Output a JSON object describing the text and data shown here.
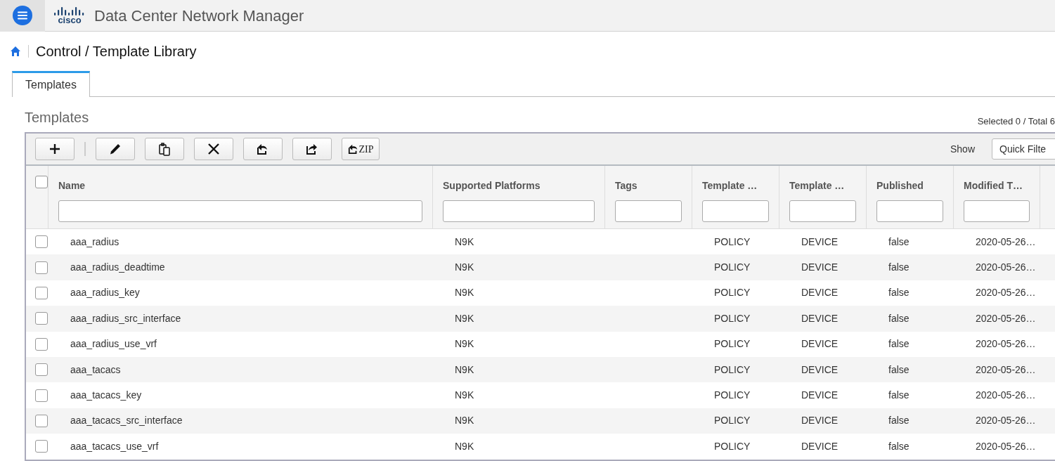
{
  "header": {
    "logo_text": "cisco",
    "title": "Data Center Network Manager"
  },
  "breadcrumb": "Control / Template Library",
  "tabs": [
    {
      "label": "Templates",
      "selected": true
    }
  ],
  "section": {
    "title": "Templates",
    "count": "Selected 0 / Total 6"
  },
  "toolbar": {
    "buttons": [
      {
        "kind": "add"
      },
      {
        "kind": "edit"
      },
      {
        "kind": "copy"
      },
      {
        "kind": "delete"
      },
      {
        "kind": "import"
      },
      {
        "kind": "export"
      },
      {
        "kind": "zip",
        "label": "ZIP"
      }
    ],
    "show_label": "Show",
    "filter": "Quick Filte"
  },
  "table": {
    "select_all": {
      "checked": false
    },
    "columns": [
      "Name",
      "Supported Platforms",
      "Tags",
      "Template …",
      "Template …",
      "Published",
      "Modified T…"
    ],
    "rows": [
      {
        "checked": false,
        "cells": [
          "aaa_radius",
          "N9K",
          "",
          "POLICY",
          "DEVICE",
          "false",
          "2020-05-26…"
        ]
      },
      {
        "checked": false,
        "cells": [
          "aaa_radius_deadtime",
          "N9K",
          "",
          "POLICY",
          "DEVICE",
          "false",
          "2020-05-26…"
        ]
      },
      {
        "checked": false,
        "cells": [
          "aaa_radius_key",
          "N9K",
          "",
          "POLICY",
          "DEVICE",
          "false",
          "2020-05-26…"
        ]
      },
      {
        "checked": false,
        "cells": [
          "aaa_radius_src_interface",
          "N9K",
          "",
          "POLICY",
          "DEVICE",
          "false",
          "2020-05-26…"
        ]
      },
      {
        "checked": false,
        "cells": [
          "aaa_radius_use_vrf",
          "N9K",
          "",
          "POLICY",
          "DEVICE",
          "false",
          "2020-05-26…"
        ]
      },
      {
        "checked": false,
        "cells": [
          "aaa_tacacs",
          "N9K",
          "",
          "POLICY",
          "DEVICE",
          "false",
          "2020-05-26…"
        ]
      },
      {
        "checked": false,
        "cells": [
          "aaa_tacacs_key",
          "N9K",
          "",
          "POLICY",
          "DEVICE",
          "false",
          "2020-05-26…"
        ]
      },
      {
        "checked": false,
        "cells": [
          "aaa_tacacs_src_interface",
          "N9K",
          "",
          "POLICY",
          "DEVICE",
          "false",
          "2020-05-26…"
        ]
      },
      {
        "checked": false,
        "cells": [
          "aaa_tacacs_use_vrf",
          "N9K",
          "",
          "POLICY",
          "DEVICE",
          "false",
          "2020-05-26…"
        ]
      }
    ]
  }
}
